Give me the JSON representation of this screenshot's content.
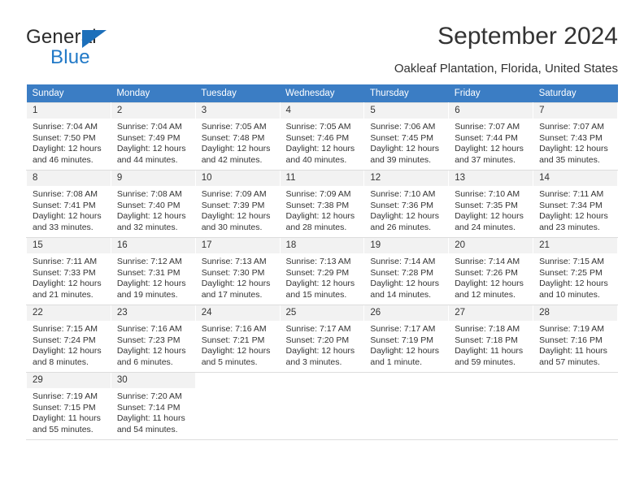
{
  "brand": {
    "name_top": "General",
    "name_bottom": "Blue",
    "accent_color": "#2179c7",
    "triangle_color": "#1c6fba"
  },
  "header": {
    "title": "September 2024",
    "subtitle": "Oakleaf Plantation, Florida, United States",
    "header_bg": "#3b7dc4",
    "daynum_bg": "#f2f2f2"
  },
  "weekdays": [
    "Sunday",
    "Monday",
    "Tuesday",
    "Wednesday",
    "Thursday",
    "Friday",
    "Saturday"
  ],
  "labels": {
    "sunrise_prefix": "Sunrise: ",
    "sunset_prefix": "Sunset: ",
    "daylight_prefix": "Daylight: "
  },
  "weeks": [
    [
      {
        "day": "1",
        "sunrise": "Sunrise: 7:04 AM",
        "sunset": "Sunset: 7:50 PM",
        "daylight": "Daylight: 12 hours and 46 minutes."
      },
      {
        "day": "2",
        "sunrise": "Sunrise: 7:04 AM",
        "sunset": "Sunset: 7:49 PM",
        "daylight": "Daylight: 12 hours and 44 minutes."
      },
      {
        "day": "3",
        "sunrise": "Sunrise: 7:05 AM",
        "sunset": "Sunset: 7:48 PM",
        "daylight": "Daylight: 12 hours and 42 minutes."
      },
      {
        "day": "4",
        "sunrise": "Sunrise: 7:05 AM",
        "sunset": "Sunset: 7:46 PM",
        "daylight": "Daylight: 12 hours and 40 minutes."
      },
      {
        "day": "5",
        "sunrise": "Sunrise: 7:06 AM",
        "sunset": "Sunset: 7:45 PM",
        "daylight": "Daylight: 12 hours and 39 minutes."
      },
      {
        "day": "6",
        "sunrise": "Sunrise: 7:07 AM",
        "sunset": "Sunset: 7:44 PM",
        "daylight": "Daylight: 12 hours and 37 minutes."
      },
      {
        "day": "7",
        "sunrise": "Sunrise: 7:07 AM",
        "sunset": "Sunset: 7:43 PM",
        "daylight": "Daylight: 12 hours and 35 minutes."
      }
    ],
    [
      {
        "day": "8",
        "sunrise": "Sunrise: 7:08 AM",
        "sunset": "Sunset: 7:41 PM",
        "daylight": "Daylight: 12 hours and 33 minutes."
      },
      {
        "day": "9",
        "sunrise": "Sunrise: 7:08 AM",
        "sunset": "Sunset: 7:40 PM",
        "daylight": "Daylight: 12 hours and 32 minutes."
      },
      {
        "day": "10",
        "sunrise": "Sunrise: 7:09 AM",
        "sunset": "Sunset: 7:39 PM",
        "daylight": "Daylight: 12 hours and 30 minutes."
      },
      {
        "day": "11",
        "sunrise": "Sunrise: 7:09 AM",
        "sunset": "Sunset: 7:38 PM",
        "daylight": "Daylight: 12 hours and 28 minutes."
      },
      {
        "day": "12",
        "sunrise": "Sunrise: 7:10 AM",
        "sunset": "Sunset: 7:36 PM",
        "daylight": "Daylight: 12 hours and 26 minutes."
      },
      {
        "day": "13",
        "sunrise": "Sunrise: 7:10 AM",
        "sunset": "Sunset: 7:35 PM",
        "daylight": "Daylight: 12 hours and 24 minutes."
      },
      {
        "day": "14",
        "sunrise": "Sunrise: 7:11 AM",
        "sunset": "Sunset: 7:34 PM",
        "daylight": "Daylight: 12 hours and 23 minutes."
      }
    ],
    [
      {
        "day": "15",
        "sunrise": "Sunrise: 7:11 AM",
        "sunset": "Sunset: 7:33 PM",
        "daylight": "Daylight: 12 hours and 21 minutes."
      },
      {
        "day": "16",
        "sunrise": "Sunrise: 7:12 AM",
        "sunset": "Sunset: 7:31 PM",
        "daylight": "Daylight: 12 hours and 19 minutes."
      },
      {
        "day": "17",
        "sunrise": "Sunrise: 7:13 AM",
        "sunset": "Sunset: 7:30 PM",
        "daylight": "Daylight: 12 hours and 17 minutes."
      },
      {
        "day": "18",
        "sunrise": "Sunrise: 7:13 AM",
        "sunset": "Sunset: 7:29 PM",
        "daylight": "Daylight: 12 hours and 15 minutes."
      },
      {
        "day": "19",
        "sunrise": "Sunrise: 7:14 AM",
        "sunset": "Sunset: 7:28 PM",
        "daylight": "Daylight: 12 hours and 14 minutes."
      },
      {
        "day": "20",
        "sunrise": "Sunrise: 7:14 AM",
        "sunset": "Sunset: 7:26 PM",
        "daylight": "Daylight: 12 hours and 12 minutes."
      },
      {
        "day": "21",
        "sunrise": "Sunrise: 7:15 AM",
        "sunset": "Sunset: 7:25 PM",
        "daylight": "Daylight: 12 hours and 10 minutes."
      }
    ],
    [
      {
        "day": "22",
        "sunrise": "Sunrise: 7:15 AM",
        "sunset": "Sunset: 7:24 PM",
        "daylight": "Daylight: 12 hours and 8 minutes."
      },
      {
        "day": "23",
        "sunrise": "Sunrise: 7:16 AM",
        "sunset": "Sunset: 7:23 PM",
        "daylight": "Daylight: 12 hours and 6 minutes."
      },
      {
        "day": "24",
        "sunrise": "Sunrise: 7:16 AM",
        "sunset": "Sunset: 7:21 PM",
        "daylight": "Daylight: 12 hours and 5 minutes."
      },
      {
        "day": "25",
        "sunrise": "Sunrise: 7:17 AM",
        "sunset": "Sunset: 7:20 PM",
        "daylight": "Daylight: 12 hours and 3 minutes."
      },
      {
        "day": "26",
        "sunrise": "Sunrise: 7:17 AM",
        "sunset": "Sunset: 7:19 PM",
        "daylight": "Daylight: 12 hours and 1 minute."
      },
      {
        "day": "27",
        "sunrise": "Sunrise: 7:18 AM",
        "sunset": "Sunset: 7:18 PM",
        "daylight": "Daylight: 11 hours and 59 minutes."
      },
      {
        "day": "28",
        "sunrise": "Sunrise: 7:19 AM",
        "sunset": "Sunset: 7:16 PM",
        "daylight": "Daylight: 11 hours and 57 minutes."
      }
    ],
    [
      {
        "day": "29",
        "sunrise": "Sunrise: 7:19 AM",
        "sunset": "Sunset: 7:15 PM",
        "daylight": "Daylight: 11 hours and 55 minutes."
      },
      {
        "day": "30",
        "sunrise": "Sunrise: 7:20 AM",
        "sunset": "Sunset: 7:14 PM",
        "daylight": "Daylight: 11 hours and 54 minutes."
      },
      {
        "day": "",
        "sunrise": "",
        "sunset": "",
        "daylight": ""
      },
      {
        "day": "",
        "sunrise": "",
        "sunset": "",
        "daylight": ""
      },
      {
        "day": "",
        "sunrise": "",
        "sunset": "",
        "daylight": ""
      },
      {
        "day": "",
        "sunrise": "",
        "sunset": "",
        "daylight": ""
      },
      {
        "day": "",
        "sunrise": "",
        "sunset": "",
        "daylight": ""
      }
    ]
  ]
}
